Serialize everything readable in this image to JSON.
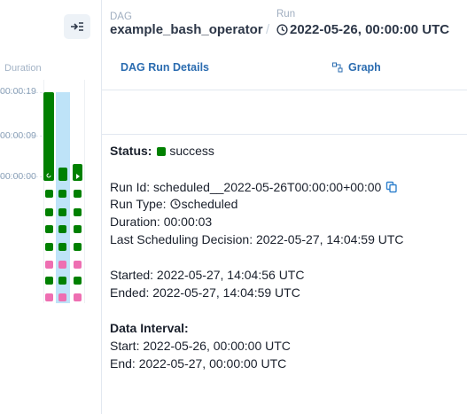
{
  "grid": {
    "duration_header": "Duration",
    "ticks": [
      "00:00:19",
      "00:00:09",
      "00:00:00"
    ],
    "success_color": "#008000",
    "up_for_retry_color": "#ee6fb2",
    "selected_run_color": "#bee3f8",
    "collapse_icon": "collapse-arrow-icon"
  },
  "breadcrumb": {
    "dag_label": "DAG",
    "dag_id": "example_bash_operator",
    "separator": "/",
    "run_label": "Run",
    "run_id": "2022-05-26, 00:00:00 UTC"
  },
  "tabs": {
    "details": "DAG Run Details",
    "graph": "Graph"
  },
  "details": {
    "status_label": "Status:",
    "status_value": "success",
    "run_id": "Run Id: scheduled__2022-05-26T00:00:00+00:00",
    "run_type_prefix": "Run Type: ",
    "run_type_value": "scheduled",
    "duration": "Duration: 00:00:03",
    "last_scheduling": "Last Scheduling Decision: 2022-05-27, 14:04:59 UTC",
    "started": "Started: 2022-05-27, 14:04:56 UTC",
    "ended": "Ended: 2022-05-27, 14:04:59 UTC",
    "data_interval_title": "Data Interval:",
    "interval_start": "Start: 2022-05-26, 00:00:00 UTC",
    "interval_end": "End: 2022-05-27, 00:00:00 UTC"
  }
}
